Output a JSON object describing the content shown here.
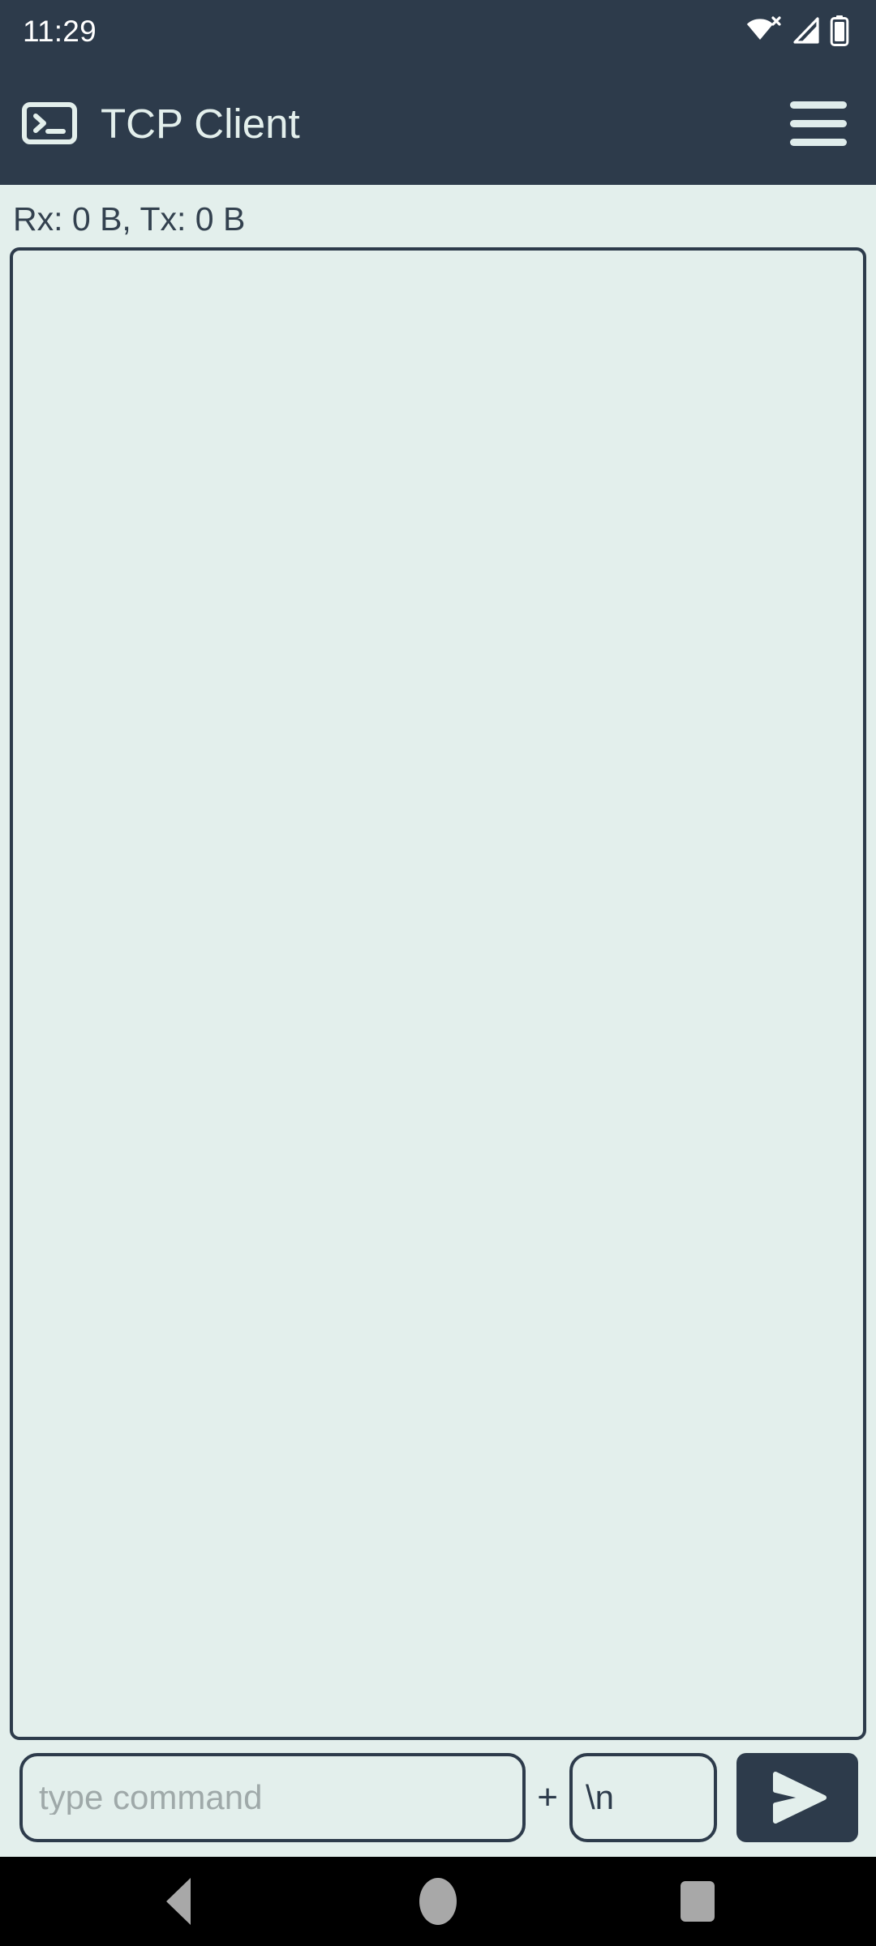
{
  "status_bar": {
    "clock": "11:29",
    "icons": [
      {
        "name": "wifi-no-internet-icon",
        "label": "Wi-Fi no internet"
      },
      {
        "name": "cellular-signal-icon",
        "label": "Cellular signal"
      },
      {
        "name": "battery-icon",
        "label": "Battery"
      }
    ]
  },
  "app_bar": {
    "icon": "terminal-icon",
    "title": "TCP Client",
    "menu_icon": "hamburger-menu-icon"
  },
  "main": {
    "stats": "Rx: 0 B, Tx: 0 B",
    "terminal_output": ""
  },
  "input_row": {
    "command_placeholder": "type command",
    "command_value": "",
    "plus_label": "+",
    "eol_value": "\\n",
    "send_icon": "send-arrow-icon"
  },
  "nav_bar": {
    "back": "back-button",
    "home": "home-button",
    "recents": "recents-button"
  },
  "colors": {
    "app_bar": "#2d3b4b",
    "background": "#e3efec",
    "accent_text": "#33414f",
    "placeholder": "#9fa9a9",
    "nav_bar": "#000000",
    "nav_icon": "#a8a8a8"
  }
}
